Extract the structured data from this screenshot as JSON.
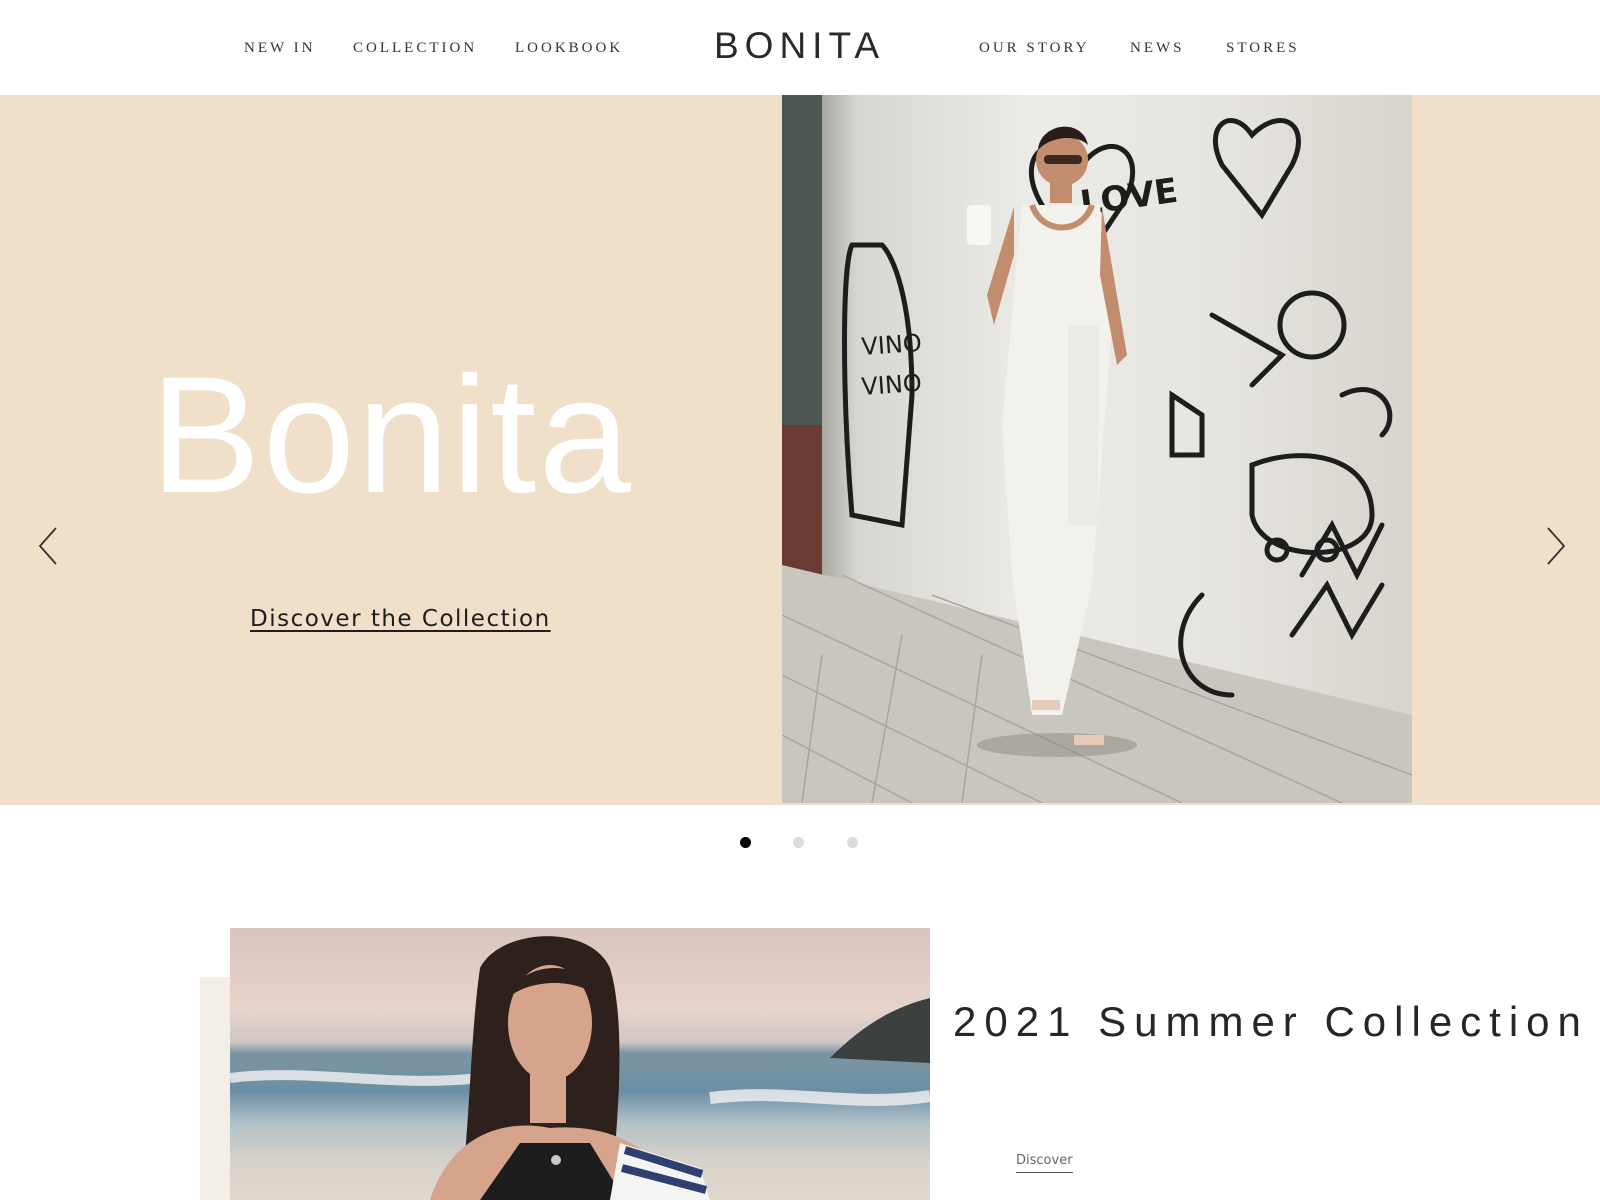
{
  "header": {
    "nav_left": [
      "NEW IN",
      "COLLECTION",
      "LOOKBOOK"
    ],
    "brand": "BONITA",
    "nav_right": [
      "OUR STORY",
      "NEWS",
      "STORES"
    ]
  },
  "hero": {
    "title": "Bonita",
    "link_label": "Discover the Collection",
    "prev_icon": "chevron-left-icon",
    "next_icon": "chevron-right-icon",
    "active_slide": 1,
    "slide_count": 3
  },
  "feature": {
    "title": "2021 Summer Collection",
    "link_label": "Discover"
  },
  "colors": {
    "hero_background": "#f0dfc9",
    "accent_block": "#f3efe8",
    "dot_active": "#000000",
    "dot_inactive": "#dcdcdc",
    "text_dark": "#262626"
  }
}
